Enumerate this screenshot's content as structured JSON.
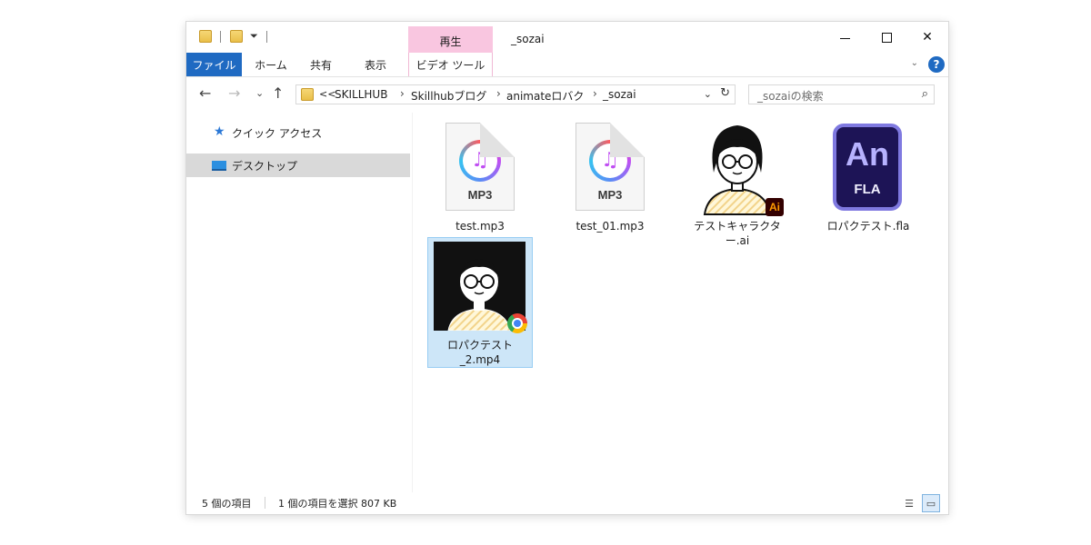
{
  "window": {
    "title": "_sozai",
    "contextual_group": "再生"
  },
  "ribbon": {
    "tabs": [
      "ファイル",
      "ホーム",
      "共有",
      "表示",
      "ビデオ ツール"
    ]
  },
  "address": {
    "overflow": "<<",
    "crumbs": [
      "SKILLHUB",
      "Skillhubブログ",
      "animateロバク",
      "_sozai"
    ]
  },
  "search": {
    "placeholder": "_sozaiの検索"
  },
  "nav_pane": {
    "items": [
      {
        "label": "クイック アクセス",
        "icon": "star-icon"
      },
      {
        "label": "デスクトップ",
        "icon": "desktop-icon",
        "selected": true
      }
    ]
  },
  "files": [
    {
      "name": "test.mp3",
      "icon": "mp3-file-icon",
      "badge": "MP3"
    },
    {
      "name": "test_01.mp3",
      "icon": "mp3-file-icon",
      "badge": "MP3"
    },
    {
      "name": "テストキャラクター.ai",
      "icon": "illustrator-character-icon",
      "badge": "Ai"
    },
    {
      "name": "ロパクテスト.fla",
      "icon": "animate-file-icon",
      "badge": "An",
      "sub": "FLA"
    },
    {
      "name_line1": "ロパクテスト",
      "name_line2": "_2.mp4",
      "icon": "video-thumbnail-icon",
      "selected": true
    }
  ],
  "status": {
    "item_count": "5 個の項目",
    "selection": "1 個の項目を選択  807 KB"
  },
  "colors": {
    "accent": "#1f6ac2",
    "context_tab": "#f9c6e0",
    "selection": "#cde6f8"
  }
}
